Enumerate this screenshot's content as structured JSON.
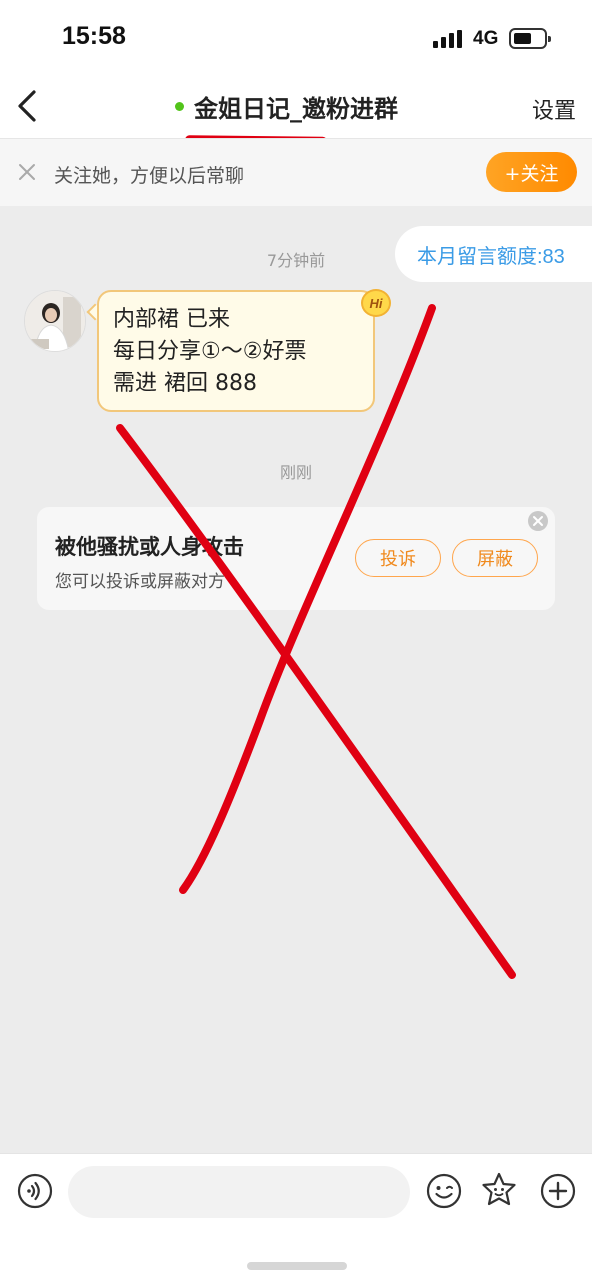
{
  "status_bar": {
    "time": "15:58",
    "network": "4G"
  },
  "nav": {
    "title": "金姐日记_邀粉进群",
    "settings_label": "设置",
    "online_color": "#52c41a"
  },
  "follow_banner": {
    "text": "关注她，方便以后常聊",
    "button_label": "+关注",
    "button_color": "#ff8a00"
  },
  "chat": {
    "timestamp_1": "7分钟前",
    "quota_label": "本月留言额度:83",
    "message_lines": [
      "内部裙 已来",
      "每日分享①～②好票",
      "需进 裙回 888"
    ],
    "hi_badge": "Hi",
    "timestamp_2": "刚刚"
  },
  "harassment_card": {
    "title": "被他骚扰或人身攻击",
    "subtitle": "您可以投诉或屏蔽对方",
    "report_label": "投诉",
    "block_label": "屏蔽"
  },
  "input_bar": {
    "placeholder": ""
  },
  "colors": {
    "annotation_red": "#e00012",
    "accent_orange": "#f08a1e",
    "link_blue": "#3a9be6"
  }
}
